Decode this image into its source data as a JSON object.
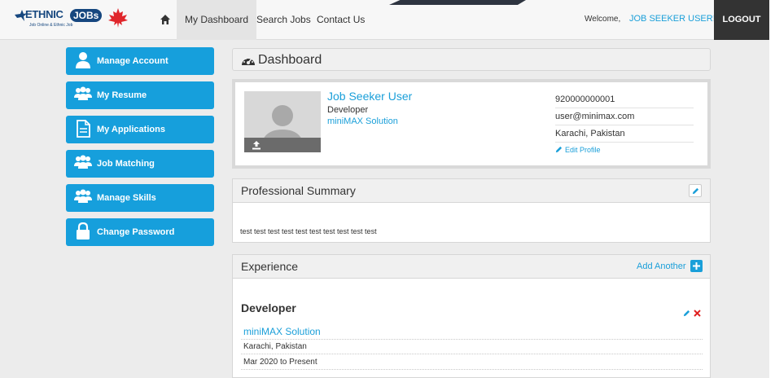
{
  "header": {
    "logo": {
      "brand_left": "ETHNIC",
      "brand_right": "JOBs",
      "tagline": "Job Online & Ethnic Job"
    },
    "nav": [
      {
        "label": "My Dashboard",
        "active": true
      },
      {
        "label": "Search Jobs",
        "active": false
      },
      {
        "label": "Contact Us",
        "active": false
      }
    ],
    "welcome": "Welcome,",
    "user_name": "JOB SEEKER USER!",
    "logout": "LOGOUT"
  },
  "sidebar": {
    "items": [
      {
        "label": "Manage Account",
        "icon": "user-icon"
      },
      {
        "label": "My Resume",
        "icon": "users-icon"
      },
      {
        "label": "My Applications",
        "icon": "document-icon"
      },
      {
        "label": "Job Matching",
        "icon": "users-icon"
      },
      {
        "label": "Manage Skills",
        "icon": "users-icon"
      },
      {
        "label": "Change Password",
        "icon": "lock-icon"
      }
    ]
  },
  "dashboard": {
    "title": "Dashboard"
  },
  "profile": {
    "name": "Job Seeker User",
    "title": "Developer",
    "company": "miniMAX Solution",
    "phone": "920000000001",
    "email": "user@minimax.com",
    "location": "Karachi, Pakistan",
    "edit_label": "Edit Profile"
  },
  "summary": {
    "title": "Professional Summary",
    "text": "test test test test test test test test test test"
  },
  "experience": {
    "title": "Experience",
    "add_label": "Add Another",
    "items": [
      {
        "position": "Developer",
        "company": "miniMAX Solution",
        "location": "Karachi, Pakistan",
        "period": "Mar 2020 to Present"
      }
    ]
  },
  "colors": {
    "accent": "#169fdc",
    "link": "#1a9fd9",
    "logout_bg": "#333333",
    "delete": "#e02020"
  }
}
